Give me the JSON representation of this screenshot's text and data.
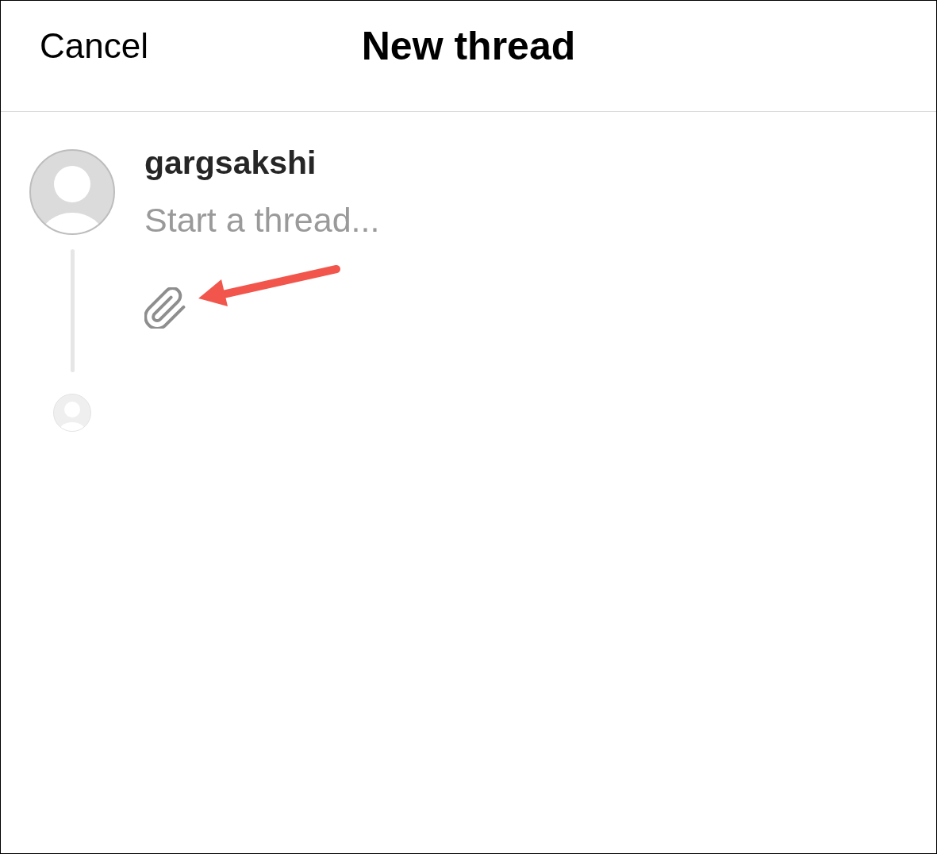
{
  "header": {
    "cancel": "Cancel",
    "title": "New thread"
  },
  "composer": {
    "username": "gargsakshi",
    "placeholder": "Start a thread..."
  }
}
